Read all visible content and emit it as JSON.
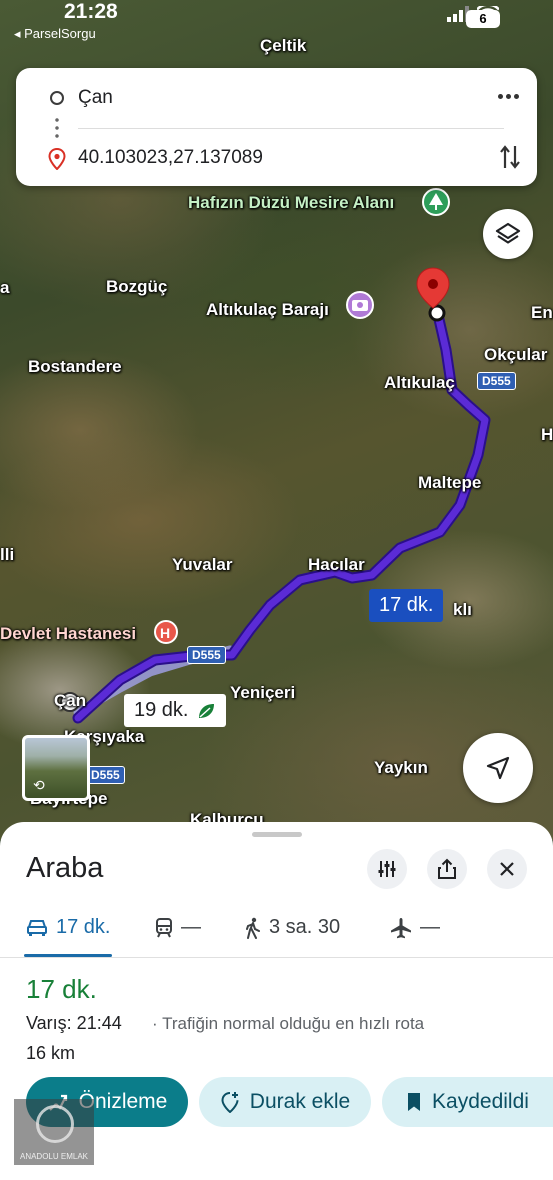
{
  "status_bar": {
    "time": "21:28",
    "back_app": "◂ ParselSorgu",
    "battery": "6"
  },
  "search": {
    "origin": "Çan",
    "destination": "40.103023,27.137089"
  },
  "map": {
    "labels": {
      "celtik": "Çeltik",
      "hafizin": "Hafızın Düzü Mesire Alanı",
      "bozguc": "Bozgüç",
      "altikulac_baraji": "Altıkulaç Barajı",
      "en": "En",
      "a_left": "a",
      "okcular": "Okçular",
      "bostandere": "Bostandere",
      "altikulac": "Altıkulaç",
      "h_right": "H",
      "maltepe": "Maltepe",
      "lli": "lli",
      "yuvalar": "Yuvalar",
      "hacilar": "Hacılar",
      "kli": "klı",
      "devlet": "Devlet Hastanesi",
      "yeniceri": "Yeniçeri",
      "can": "Çan",
      "karsiyaka": "Karşıyaka",
      "yaykin": "Yaykın",
      "bayirtepe": "Bayırtepe",
      "kalburcu": "Kalburcu"
    },
    "road_shields": {
      "d555_a": "D555",
      "d555_b": "D555",
      "d555_c": "D555"
    },
    "route_bubbles": {
      "primary": "17 dk.",
      "alternative": "19 dk."
    }
  },
  "sheet": {
    "title": "Araba",
    "tabs": {
      "car": "17 dk.",
      "transit": "—",
      "walk": "3 sa. 30",
      "flight": "—"
    },
    "duration": "17 dk.",
    "arrival": "Varış: 21:44",
    "description": "· Trafiğin normal olduğu en hızlı rota",
    "distance": "16 km",
    "actions": {
      "preview": "Önizleme",
      "add_stop": "Durak ekle",
      "saved": "Kaydedildi"
    }
  },
  "watermark": "ANADOLU EMLAK",
  "colors": {
    "route": "#5b2bd6",
    "accent_green": "#188038",
    "primary_blue": "#1a6ba8",
    "button_teal": "#0b7d8a"
  }
}
